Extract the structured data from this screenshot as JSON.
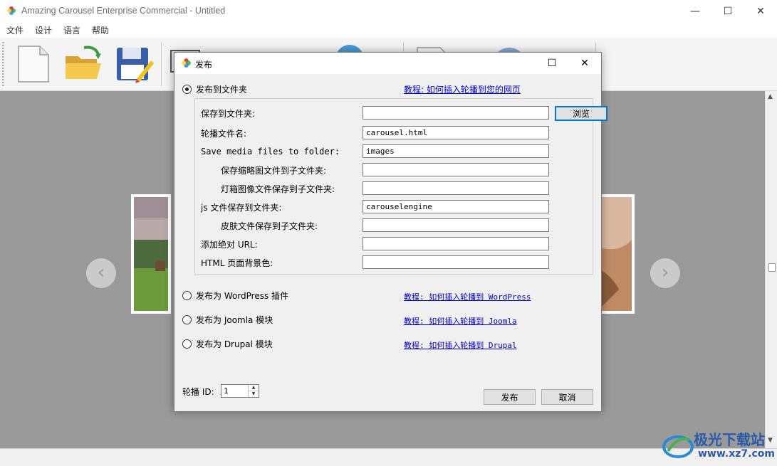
{
  "window": {
    "title": "Amazing Carousel Enterprise Commercial - Untitled",
    "minimize": "—",
    "maximize": "☐",
    "close": "✕"
  },
  "menu": [
    "文件",
    "设计",
    "语言",
    "帮助"
  ],
  "toolbar_icons": [
    "new-file-icon",
    "open-folder-icon",
    "save-icon",
    "screen-icon",
    "bell-icon",
    "globe-icon",
    "document-icon",
    "circle-icon",
    "red-icon"
  ],
  "carousel": {
    "prev_glyph": "‹",
    "next_glyph": "›"
  },
  "dialog": {
    "title": "发布",
    "publish_folder_label": "发布到文件夹",
    "publish_folder_tutorial": "教程: 如何插入轮播到您的网页",
    "fields": {
      "save_folder_label": "保存到文件夹:",
      "save_folder_value": "",
      "browse_label": "浏览",
      "carousel_file_label": "轮播文件名:",
      "carousel_file_value": "carousel.html",
      "media_folder_label": "Save media files to folder:",
      "media_folder_value": "images",
      "thumbs_label": "保存缩略图文件到子文件夹:",
      "thumbs_value": "",
      "lightbox_label": "灯箱图像文件保存到子文件夹:",
      "lightbox_value": "",
      "js_label": "js 文件保存到文件夹:",
      "js_value": "carouselengine",
      "skin_label": "皮肤文件保存到子文件夹:",
      "skin_value": "",
      "absolute_url_label": "添加绝对 URL:",
      "absolute_url_value": "",
      "bg_color_label": "HTML 页面背景色:",
      "bg_color_value": ""
    },
    "wordpress_label": "发布为 WordPress 插件",
    "wordpress_tutorial": "教程: 如何插入轮播到 WordPress",
    "joomla_label": "发布为 Joomla 模块",
    "joomla_tutorial": "教程: 如何插入轮播到 Joomla",
    "drupal_label": "发布为 Drupal 模块",
    "drupal_tutorial": "教程: 如何插入轮播到 Drupal",
    "carousel_id_label": "轮播 ID:",
    "carousel_id_value": "1",
    "publish_button": "发布",
    "cancel_button": "取消",
    "selected_option": "folder"
  },
  "watermark": {
    "brand": "极光下载站",
    "url": "www.xz7.com"
  },
  "colors": {
    "link": "#0000cc",
    "canvas": "#9a9a9a",
    "dialog_bg": "#f0f0f0",
    "focus": "#0078d7"
  }
}
